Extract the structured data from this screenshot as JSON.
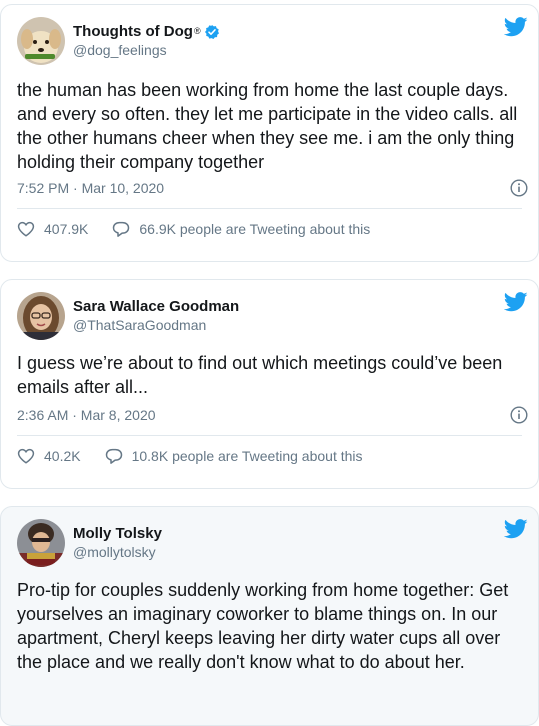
{
  "tweets": [
    {
      "name": "Thoughts of Dog",
      "registered": "®",
      "verified": true,
      "handle": "@dog_feelings",
      "text": "the human has been working from home the last couple days. and every so often. they let me participate in the video calls. all the other humans cheer when they see me. i am the only thing holding their company together",
      "timestamp": "7:52 PM · Mar 10, 2020",
      "likes": "407.9K",
      "conversation": "66.9K people are Tweeting about this"
    },
    {
      "name": "Sara Wallace Goodman",
      "handle": "@ThatSaraGoodman",
      "text": "I guess we’re about to find out which meetings could’ve been emails after all...",
      "timestamp": "2:36 AM · Mar 8, 2020",
      "likes": "40.2K",
      "conversation": "10.8K people are Tweeting about this"
    },
    {
      "name": "Molly Tolsky",
      "handle": "@mollytolsky",
      "text": "Pro-tip for couples suddenly working from home together: Get yourselves an imaginary coworker to blame things on. In our apartment, Cheryl keeps leaving her dirty water cups all over the place and we really don't know what to do about her."
    }
  ],
  "colors": {
    "twitter_blue": "#1da1f2",
    "secondary_text": "#657786",
    "border": "#e1e8ed"
  },
  "icons": [
    "twitter-bird-icon",
    "verified-badge-icon",
    "info-icon",
    "heart-icon",
    "speech-bubble-icon"
  ]
}
